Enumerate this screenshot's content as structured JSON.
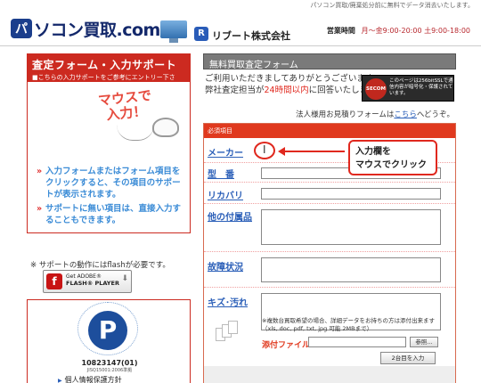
{
  "top_note": "パソコン買取/廃棄処分前に無料でデータ消去いたします。",
  "header": {
    "brand_mark": "パ",
    "brand": "ソコン買取.com",
    "company_mark": "R",
    "company": "リブート株式会社",
    "hours_label": "営業時間",
    "hours_value": "月～金9:00-20:00 土9:00-18:00"
  },
  "left": {
    "title": "査定フォーム・入力サポート",
    "subtitle": "■こちらの入力サポートをご参考にエントリー下さい。",
    "mouse_title_1": "マウスで",
    "mouse_title_2": "入力！",
    "tips": [
      "入力フォームまたはフォーム項目をクリックすると、その項目のサポートが表示されます。",
      "サポートに無い項目は、直接入力することもできます。"
    ],
    "flash_note": "※ サポートの動作にはflashが必要です。",
    "flash": {
      "t1": "Get ADOBE®",
      "t2": "FLASH® PLAYER",
      "icon": "f"
    },
    "privacy": {
      "mark": "P",
      "number": "10823147(01)",
      "sub": "JISQ15001:2006準拠",
      "link": "個人情報保護方針"
    }
  },
  "right": {
    "title": "無料買取査定フォーム",
    "msg_line1": "ご利用いただきましてありがとうございます。",
    "msg_line2_a": "弊社査定担当が",
    "msg_line2_red": "24時間以内",
    "msg_line2_b": "に回答いたします。",
    "secom_logo": "SECOM",
    "secom_text": "このページは256bitSSLで通信内容が暗号化・保護されています。",
    "corp_a": "法人様用お見積りフォームは",
    "corp_link": "こちら",
    "corp_b": "へどうぞ。",
    "required": "必須項目",
    "fields": [
      {
        "label": "メーカー"
      },
      {
        "label": "型　番"
      },
      {
        "label": "リカバリ"
      },
      {
        "label": "他の付属品"
      },
      {
        "label": "故障状況"
      },
      {
        "label": "キズ･汚れ"
      }
    ],
    "callout_1": "入力欄を",
    "callout_2": "マウスでクリック",
    "ibeam": "I",
    "second_item_btn": "2台目を入力",
    "attach_note": "※複数台買取希望の場合、詳細データをお持ちの方は添付出来ます（xls, doc, pdf, txt, jpg 可能 2MBまで）",
    "attach_label": "添付ファイル",
    "browse_btn": "参照..."
  }
}
